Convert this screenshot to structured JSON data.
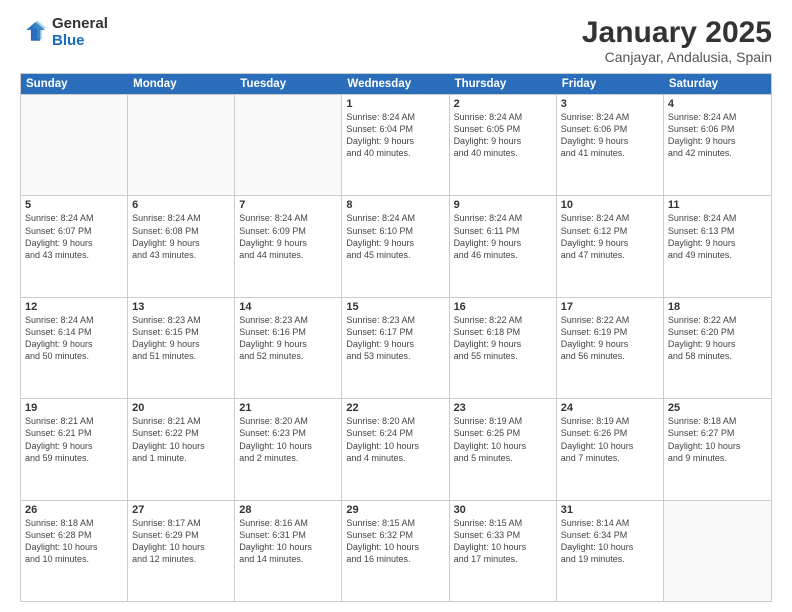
{
  "logo": {
    "general": "General",
    "blue": "Blue"
  },
  "header": {
    "title": "January 2025",
    "subtitle": "Canjayar, Andalusia, Spain"
  },
  "days": [
    "Sunday",
    "Monday",
    "Tuesday",
    "Wednesday",
    "Thursday",
    "Friday",
    "Saturday"
  ],
  "weeks": [
    [
      {
        "date": "",
        "info": ""
      },
      {
        "date": "",
        "info": ""
      },
      {
        "date": "",
        "info": ""
      },
      {
        "date": "1",
        "info": "Sunrise: 8:24 AM\nSunset: 6:04 PM\nDaylight: 9 hours\nand 40 minutes."
      },
      {
        "date": "2",
        "info": "Sunrise: 8:24 AM\nSunset: 6:05 PM\nDaylight: 9 hours\nand 40 minutes."
      },
      {
        "date": "3",
        "info": "Sunrise: 8:24 AM\nSunset: 6:06 PM\nDaylight: 9 hours\nand 41 minutes."
      },
      {
        "date": "4",
        "info": "Sunrise: 8:24 AM\nSunset: 6:06 PM\nDaylight: 9 hours\nand 42 minutes."
      }
    ],
    [
      {
        "date": "5",
        "info": "Sunrise: 8:24 AM\nSunset: 6:07 PM\nDaylight: 9 hours\nand 43 minutes."
      },
      {
        "date": "6",
        "info": "Sunrise: 8:24 AM\nSunset: 6:08 PM\nDaylight: 9 hours\nand 43 minutes."
      },
      {
        "date": "7",
        "info": "Sunrise: 8:24 AM\nSunset: 6:09 PM\nDaylight: 9 hours\nand 44 minutes."
      },
      {
        "date": "8",
        "info": "Sunrise: 8:24 AM\nSunset: 6:10 PM\nDaylight: 9 hours\nand 45 minutes."
      },
      {
        "date": "9",
        "info": "Sunrise: 8:24 AM\nSunset: 6:11 PM\nDaylight: 9 hours\nand 46 minutes."
      },
      {
        "date": "10",
        "info": "Sunrise: 8:24 AM\nSunset: 6:12 PM\nDaylight: 9 hours\nand 47 minutes."
      },
      {
        "date": "11",
        "info": "Sunrise: 8:24 AM\nSunset: 6:13 PM\nDaylight: 9 hours\nand 49 minutes."
      }
    ],
    [
      {
        "date": "12",
        "info": "Sunrise: 8:24 AM\nSunset: 6:14 PM\nDaylight: 9 hours\nand 50 minutes."
      },
      {
        "date": "13",
        "info": "Sunrise: 8:23 AM\nSunset: 6:15 PM\nDaylight: 9 hours\nand 51 minutes."
      },
      {
        "date": "14",
        "info": "Sunrise: 8:23 AM\nSunset: 6:16 PM\nDaylight: 9 hours\nand 52 minutes."
      },
      {
        "date": "15",
        "info": "Sunrise: 8:23 AM\nSunset: 6:17 PM\nDaylight: 9 hours\nand 53 minutes."
      },
      {
        "date": "16",
        "info": "Sunrise: 8:22 AM\nSunset: 6:18 PM\nDaylight: 9 hours\nand 55 minutes."
      },
      {
        "date": "17",
        "info": "Sunrise: 8:22 AM\nSunset: 6:19 PM\nDaylight: 9 hours\nand 56 minutes."
      },
      {
        "date": "18",
        "info": "Sunrise: 8:22 AM\nSunset: 6:20 PM\nDaylight: 9 hours\nand 58 minutes."
      }
    ],
    [
      {
        "date": "19",
        "info": "Sunrise: 8:21 AM\nSunset: 6:21 PM\nDaylight: 9 hours\nand 59 minutes."
      },
      {
        "date": "20",
        "info": "Sunrise: 8:21 AM\nSunset: 6:22 PM\nDaylight: 10 hours\nand 1 minute."
      },
      {
        "date": "21",
        "info": "Sunrise: 8:20 AM\nSunset: 6:23 PM\nDaylight: 10 hours\nand 2 minutes."
      },
      {
        "date": "22",
        "info": "Sunrise: 8:20 AM\nSunset: 6:24 PM\nDaylight: 10 hours\nand 4 minutes."
      },
      {
        "date": "23",
        "info": "Sunrise: 8:19 AM\nSunset: 6:25 PM\nDaylight: 10 hours\nand 5 minutes."
      },
      {
        "date": "24",
        "info": "Sunrise: 8:19 AM\nSunset: 6:26 PM\nDaylight: 10 hours\nand 7 minutes."
      },
      {
        "date": "25",
        "info": "Sunrise: 8:18 AM\nSunset: 6:27 PM\nDaylight: 10 hours\nand 9 minutes."
      }
    ],
    [
      {
        "date": "26",
        "info": "Sunrise: 8:18 AM\nSunset: 6:28 PM\nDaylight: 10 hours\nand 10 minutes."
      },
      {
        "date": "27",
        "info": "Sunrise: 8:17 AM\nSunset: 6:29 PM\nDaylight: 10 hours\nand 12 minutes."
      },
      {
        "date": "28",
        "info": "Sunrise: 8:16 AM\nSunset: 6:31 PM\nDaylight: 10 hours\nand 14 minutes."
      },
      {
        "date": "29",
        "info": "Sunrise: 8:15 AM\nSunset: 6:32 PM\nDaylight: 10 hours\nand 16 minutes."
      },
      {
        "date": "30",
        "info": "Sunrise: 8:15 AM\nSunset: 6:33 PM\nDaylight: 10 hours\nand 17 minutes."
      },
      {
        "date": "31",
        "info": "Sunrise: 8:14 AM\nSunset: 6:34 PM\nDaylight: 10 hours\nand 19 minutes."
      },
      {
        "date": "",
        "info": ""
      }
    ]
  ]
}
